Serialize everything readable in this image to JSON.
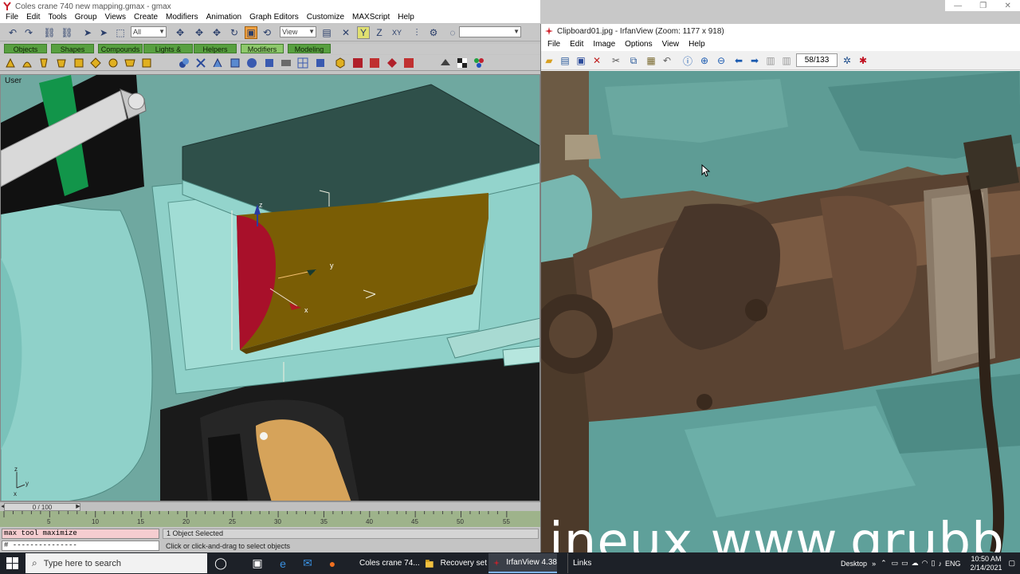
{
  "gmax": {
    "title": "Coles crane 740 new mapping.gmax - gmax",
    "menu": [
      "File",
      "Edit",
      "Tools",
      "Group",
      "Views",
      "Create",
      "Modifiers",
      "Animation",
      "Graph Editors",
      "Customize",
      "MAXScript",
      "Help"
    ],
    "toolbar": {
      "selection_filter": "All",
      "coord_system": "View"
    },
    "command_tabs": [
      "Objects",
      "Shapes",
      "Compounds",
      "Lights & Cameras",
      "Helpers",
      "Modifiers",
      "Modeling"
    ],
    "active_tab": "Modifiers",
    "viewport": {
      "label": "User",
      "gizmo_labels": {
        "z": "z",
        "y": "y",
        "x": "x"
      },
      "corner_axis": {
        "z": "z",
        "y": "y",
        "x": "x"
      }
    },
    "timeline": {
      "frame_display": "0 / 100",
      "ticks": [
        "5",
        "10",
        "15",
        "20",
        "25",
        "30",
        "35",
        "40",
        "45",
        "50",
        "55"
      ]
    },
    "status": {
      "maxscript_input": "max tool maximize",
      "maxscript_output": "# ---------------",
      "selection": "1 Object Selected",
      "hint": "Click or click-and-drag to select objects"
    },
    "colors": {
      "viewport_bg": "#6fa8a0",
      "tab_green": "#58a040",
      "mesh_teal": "#8fd1c9",
      "red_face": "#a8102a",
      "gold_face": "#7a5d05"
    }
  },
  "irfanview": {
    "title": "Clipboard01.jpg - IrfanView (Zoom: 1177 x 918)",
    "menu": [
      "File",
      "Edit",
      "Image",
      "Options",
      "View",
      "Help"
    ],
    "page_counter": "58/133",
    "watermark": "ineux www.grubb"
  },
  "taskbar": {
    "search_placeholder": "Type here to search",
    "apps": [
      {
        "label": "Coles crane 74...",
        "icon": "gmax-icon"
      },
      {
        "label": "Recovery set",
        "icon": "folder-icon"
      },
      {
        "label": "IrfanView 4.38",
        "icon": "irfanview-icon"
      }
    ],
    "links_label": "Links",
    "desktop_label": "Desktop",
    "language": "ENG",
    "time": "10:50 AM",
    "date": "2/14/2021"
  }
}
